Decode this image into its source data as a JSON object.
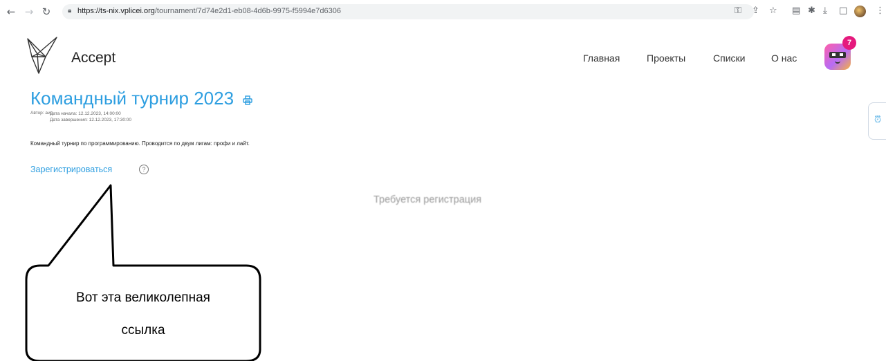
{
  "browser": {
    "url_host": "https://ts-nix.vplicei.org",
    "url_path": "/tournament/7d74e2d1-eb08-4d6b-9975-f5994e7d6306"
  },
  "site": {
    "brand": "Accept",
    "menu": [
      "Главная",
      "Проекты",
      "Списки",
      "О нас"
    ],
    "notification_count": "7"
  },
  "tournament": {
    "title": "Командный турнир 2023",
    "author": "Автор: avu",
    "start": "Дата начала: 12.12.2023, 14:00:00",
    "end": "Дата завершения: 12.12.2023, 17:30:00",
    "description": "Командный турнир по программированию. Проводится по двум лигам: профи и лайт.",
    "register_label": "Зарегистрироваться",
    "registration_required": "Требуется регистрация"
  },
  "callout": {
    "line1": "Вот эта великолепная",
    "line2": "ссылка"
  },
  "colors": {
    "accent": "#2d9ee0",
    "badge": "#e5197d"
  }
}
